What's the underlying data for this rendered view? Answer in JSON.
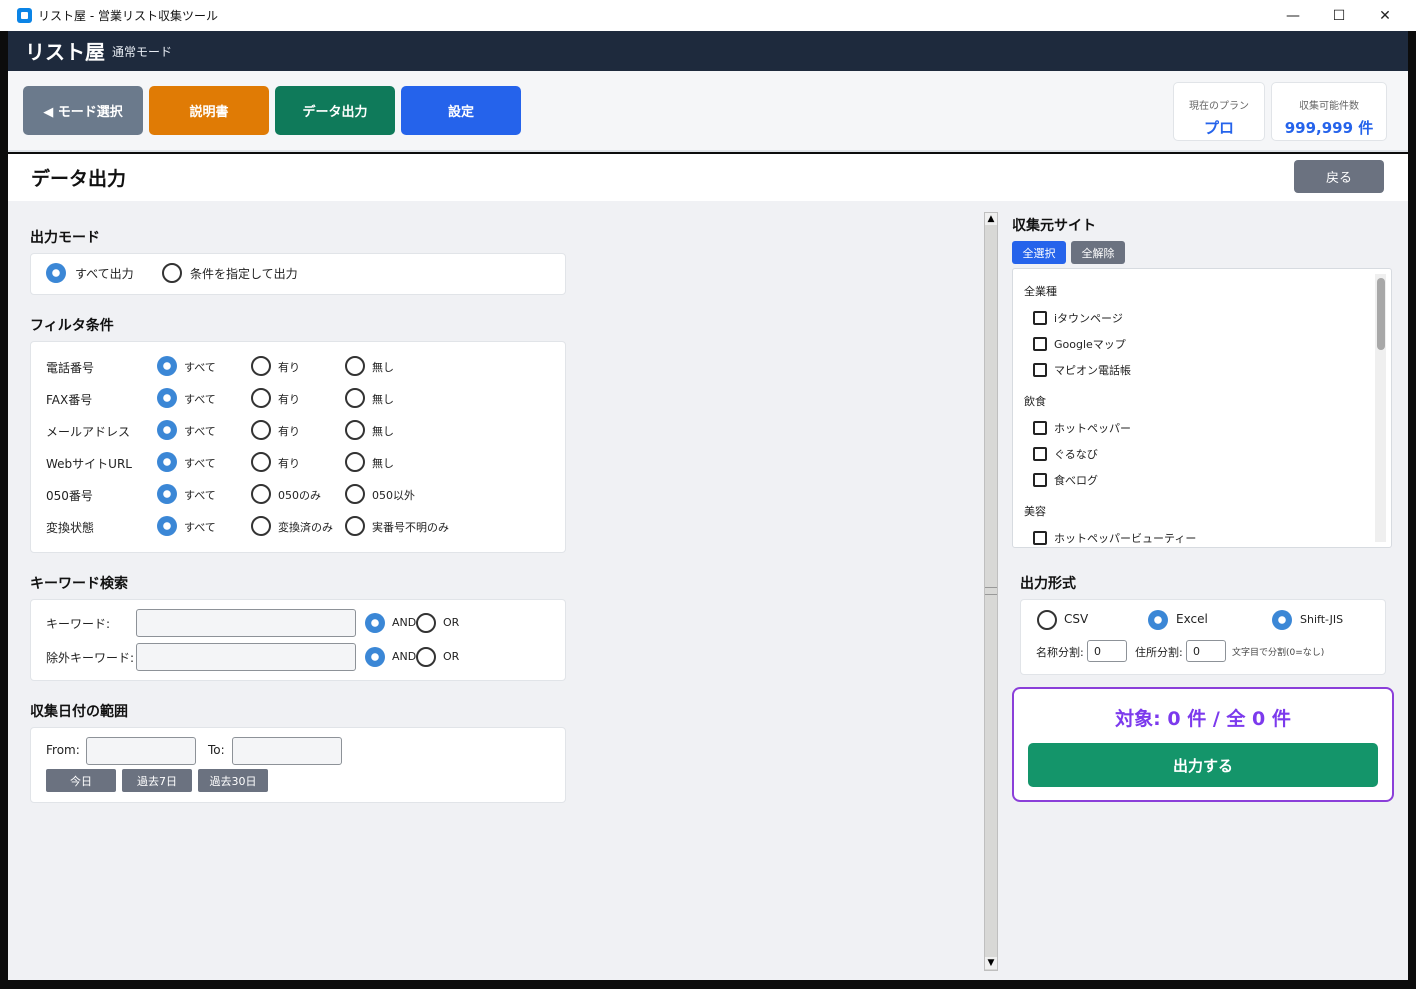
{
  "window": {
    "title": "リスト屋 - 営業リスト収集ツール",
    "minimize": "—",
    "maximize": "☐",
    "close": "✕"
  },
  "header": {
    "app_name": "リスト屋",
    "mode": "通常モード"
  },
  "toolbar": {
    "mode_select": "◀ モード選択",
    "manual": "説明書",
    "data_export": "データ出力",
    "settings": "設定",
    "plan_label": "現在のプラン",
    "plan_value": "プロ",
    "quota_label": "収集可能件数",
    "quota_value": "999,999 件"
  },
  "page": {
    "title": "データ出力",
    "back": "戻る"
  },
  "output_mode": {
    "title": "出力モード",
    "all": "すべて出力",
    "conditional": "条件を指定して出力"
  },
  "filter": {
    "title": "フィルタ条件",
    "rows": [
      {
        "label": "電話番号",
        "options": [
          "すべて",
          "有り",
          "無し"
        ]
      },
      {
        "label": "FAX番号",
        "options": [
          "すべて",
          "有り",
          "無し"
        ]
      },
      {
        "label": "メールアドレス",
        "options": [
          "すべて",
          "有り",
          "無し"
        ]
      },
      {
        "label": "WebサイトURL",
        "options": [
          "すべて",
          "有り",
          "無し"
        ]
      },
      {
        "label": "050番号",
        "options": [
          "すべて",
          "050のみ",
          "050以外"
        ]
      },
      {
        "label": "変換状態",
        "options": [
          "すべて",
          "変換済のみ",
          "実番号不明のみ"
        ]
      }
    ]
  },
  "keyword": {
    "title": "キーワード検索",
    "keyword_label": "キーワード:",
    "exclude_label": "除外キーワード:",
    "and": "AND",
    "or": "OR"
  },
  "date": {
    "title": "収集日付の範囲",
    "from": "From:",
    "to": "To:",
    "today": "今日",
    "past7": "過去7日",
    "past30": "過去30日"
  },
  "sites": {
    "title": "収集元サイト",
    "select_all": "全選択",
    "clear_all": "全解除",
    "groups": [
      {
        "category": "全業種",
        "items": [
          "iタウンページ",
          "Googleマップ",
          "マピオン電話帳"
        ]
      },
      {
        "category": "飲食",
        "items": [
          "ホットペッパー",
          "ぐるなび",
          "食べログ"
        ]
      },
      {
        "category": "美容",
        "items": [
          "ホットペッパービューティー"
        ]
      }
    ]
  },
  "format": {
    "title": "出力形式",
    "csv": "CSV",
    "excel": "Excel",
    "sjis": "Shift-JIS",
    "name_split": "名称分割:",
    "name_split_value": "0",
    "addr_split": "住所分割:",
    "addr_split_value": "0",
    "split_hint": "文字目で分割(0=なし)"
  },
  "summary": {
    "target": "対象: 0 件 / 全 0 件",
    "export": "出力する"
  },
  "colors": {
    "header_bg": "#1e2a3d",
    "accent_blue": "#2563eb",
    "orange": "#e07b05",
    "green": "#0f7a5a",
    "gray": "#6b7280",
    "radio_on": "#3b87d6",
    "purple": "#8b3fd9",
    "export_green": "#14956a"
  }
}
